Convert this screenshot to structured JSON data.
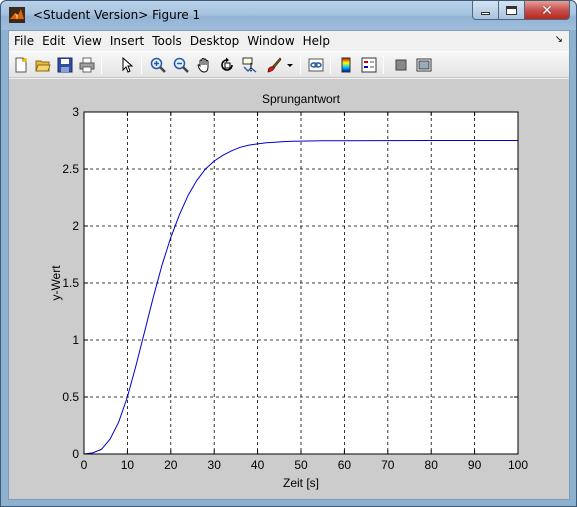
{
  "window": {
    "title": "<Student Version> Figure 1"
  },
  "menubar": {
    "items": [
      "File",
      "Edit",
      "View",
      "Insert",
      "Tools",
      "Desktop",
      "Window",
      "Help"
    ]
  },
  "toolbar": {
    "buttons": [
      {
        "icon": "new-figure-icon"
      },
      {
        "icon": "open-file-icon"
      },
      {
        "icon": "save-icon"
      },
      {
        "icon": "print-icon"
      },
      {
        "icon": "edit-plot-arrow-icon"
      },
      {
        "icon": "zoom-in-icon"
      },
      {
        "icon": "zoom-out-icon"
      },
      {
        "icon": "pan-hand-icon"
      },
      {
        "icon": "rotate-3d-icon"
      },
      {
        "icon": "data-cursor-icon"
      },
      {
        "icon": "brush-icon"
      },
      {
        "icon": "link-plot-icon"
      },
      {
        "icon": "colorbar-icon"
      },
      {
        "icon": "legend-icon"
      },
      {
        "icon": "hide-plot-tools-icon"
      },
      {
        "icon": "show-plot-tools-icon"
      }
    ]
  },
  "colors": {
    "figure_bg": "#cccccc",
    "axes_bg": "#ffffff",
    "line": "#0000cc"
  },
  "chart_data": {
    "type": "line",
    "title": "Sprungantwort",
    "xlabel": "Zeit [s]",
    "ylabel": "y-Wert",
    "xlim": [
      0,
      100
    ],
    "ylim": [
      0,
      3
    ],
    "xticks": [
      "0",
      "10",
      "20",
      "30",
      "40",
      "50",
      "60",
      "70",
      "80",
      "90",
      "100"
    ],
    "yticks": [
      "0",
      "0.5",
      "1",
      "1.5",
      "2",
      "2.5",
      "3"
    ],
    "grid": true,
    "grid_style": "dashed",
    "series": [
      {
        "color": "#0000cc",
        "x": [
          0,
          2,
          4,
          6,
          8,
          10,
          12,
          14,
          16,
          18,
          20,
          22,
          24,
          26,
          28,
          30,
          32,
          34,
          36,
          38,
          40,
          42,
          44,
          46,
          48,
          50,
          55,
          60,
          70,
          80,
          90,
          100
        ],
        "y": [
          0,
          0.01,
          0.04,
          0.13,
          0.28,
          0.5,
          0.78,
          1.08,
          1.38,
          1.66,
          1.9,
          2.1,
          2.27,
          2.4,
          2.5,
          2.57,
          2.62,
          2.66,
          2.69,
          2.71,
          2.72,
          2.73,
          2.735,
          2.74,
          2.743,
          2.745,
          2.747,
          2.748,
          2.749,
          2.75,
          2.75,
          2.75
        ]
      }
    ]
  }
}
